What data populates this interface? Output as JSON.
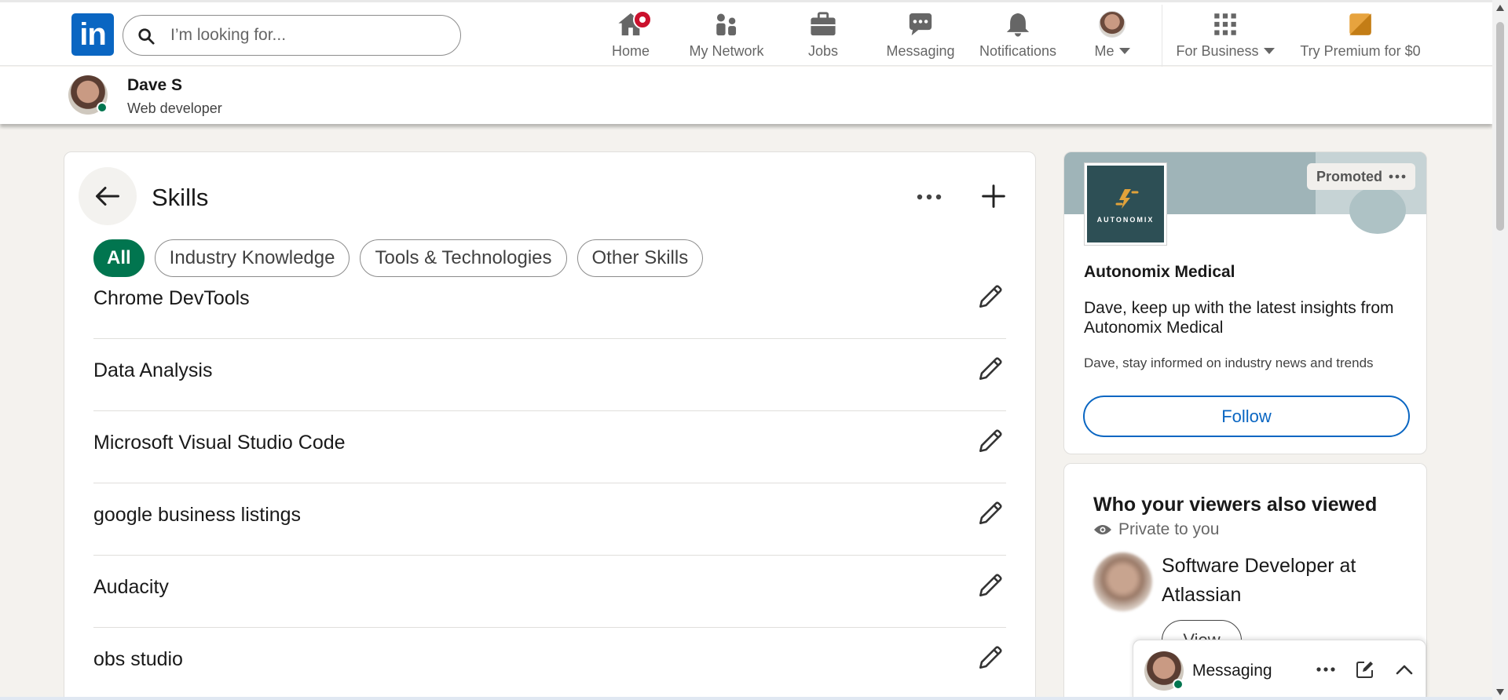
{
  "nav": {
    "search_placeholder": "I’m looking for...",
    "items": [
      {
        "label": "Home",
        "icon": "home-icon",
        "badge": true
      },
      {
        "label": "My Network",
        "icon": "network-icon"
      },
      {
        "label": "Jobs",
        "icon": "briefcase-icon"
      },
      {
        "label": "Messaging",
        "icon": "chat-icon"
      },
      {
        "label": "Notifications",
        "icon": "bell-icon"
      },
      {
        "label": "Me",
        "icon": "avatar"
      }
    ],
    "business_label": "For Business",
    "premium_label": "Try Premium for $0"
  },
  "profile": {
    "name": "Dave S",
    "title": "Web developer"
  },
  "skills": {
    "title": "Skills",
    "filters": [
      "All",
      "Industry Knowledge",
      "Tools & Technologies",
      "Other Skills"
    ],
    "active_filter": "All",
    "items": [
      "Chrome DevTools",
      "Data Analysis",
      "Microsoft Visual Studio Code",
      "google business listings",
      "Audacity",
      "obs studio"
    ]
  },
  "promo": {
    "promoted_label": "Promoted",
    "logo_text": "AUTONOMIX",
    "company": "Autonomix Medical",
    "message": "Dave, keep up with the latest insights from Autonomix Medical",
    "sub": "Dave, stay informed on industry news and trends",
    "follow_label": "Follow"
  },
  "viewers": {
    "title": "Who your viewers also viewed",
    "private_label": "Private to you",
    "role": "Software Developer at Atlassian",
    "view_label": "View"
  },
  "messaging": {
    "label": "Messaging"
  },
  "colors": {
    "brand_blue": "#0a66c2",
    "active_green": "#01754f",
    "notification_red": "#cb112d",
    "page_bg": "#f4f2ee"
  }
}
